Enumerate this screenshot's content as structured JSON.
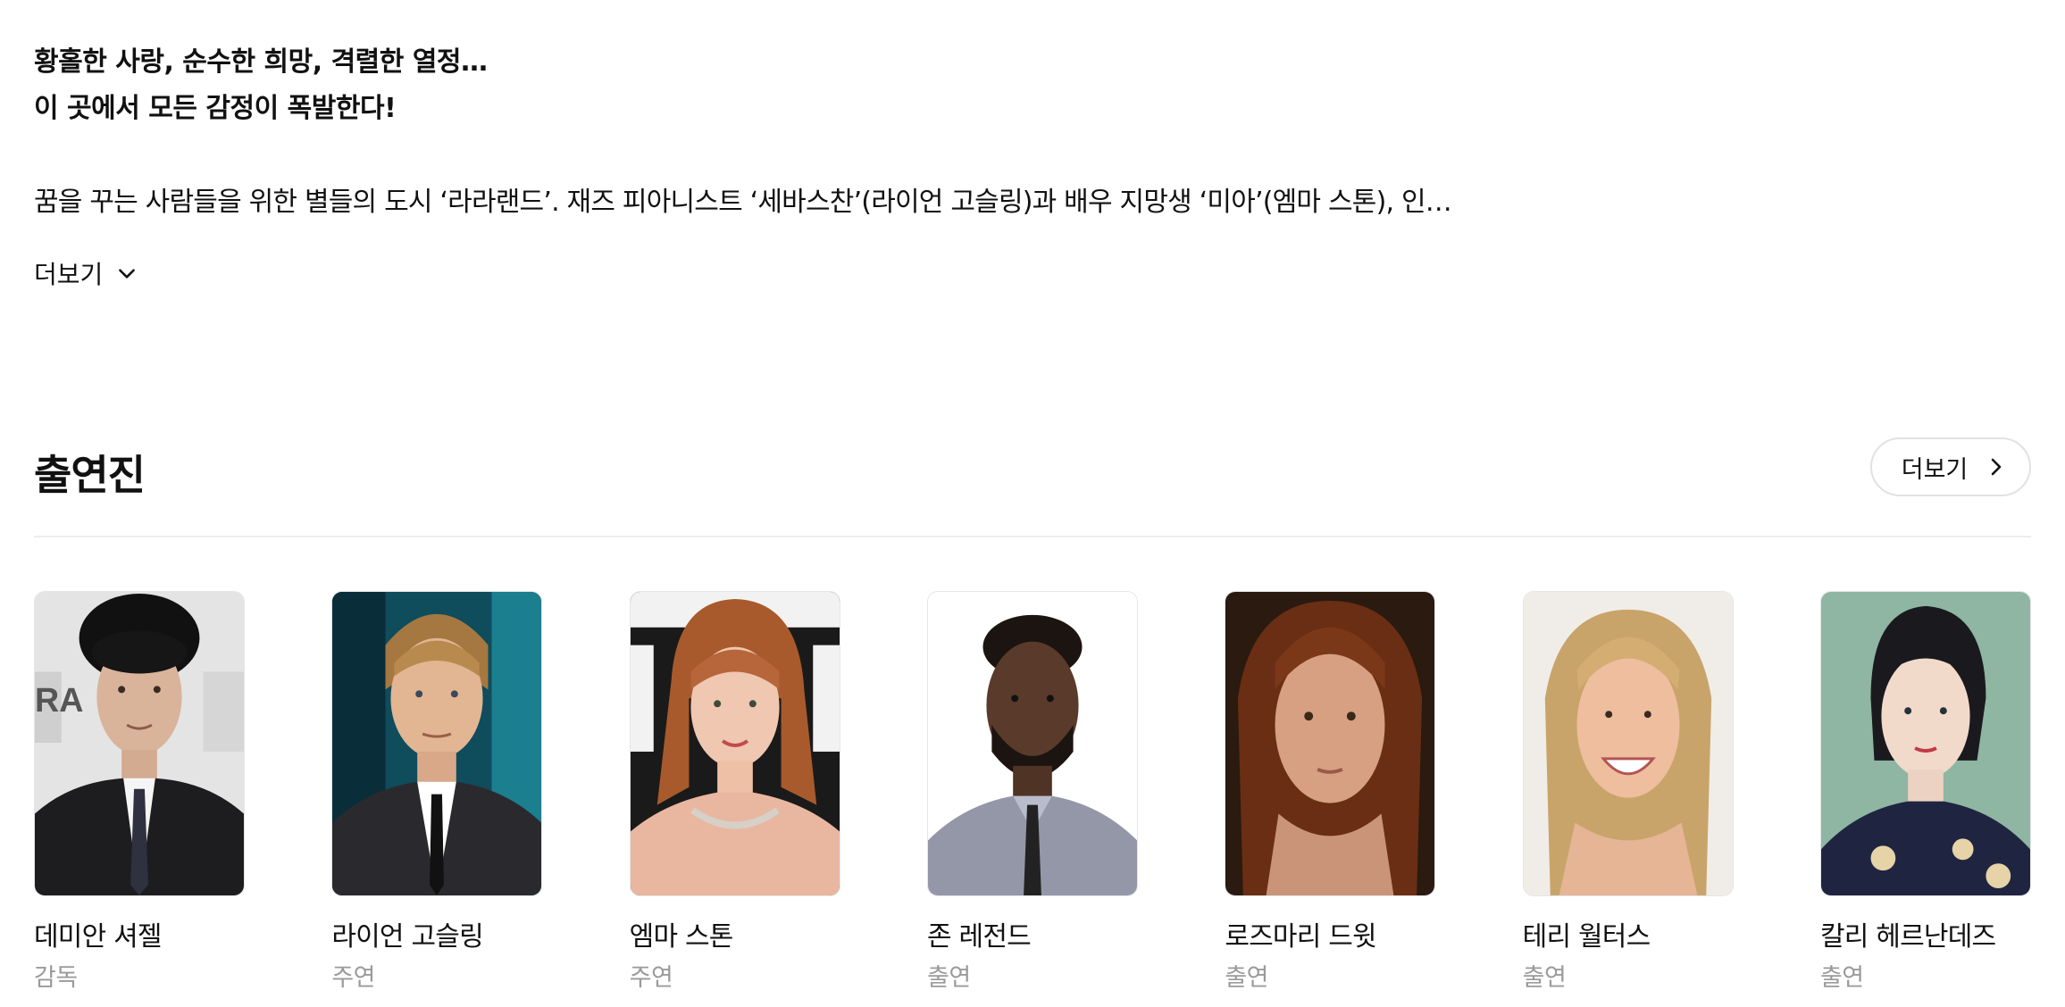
{
  "synopsis": {
    "tagline_line1": "황홀한 사랑, 순수한 희망, 격렬한 열정…",
    "tagline_line2": "이 곳에서 모든 감정이 폭발한다!",
    "body": "꿈을 꾸는 사람들을 위한 별들의 도시 ‘라라랜드’. 재즈 피아니스트 ‘세바스찬’(라이언 고슬링)과 배우 지망생 ‘미아’(엠마 스톤), 인…",
    "more_label": "더보기"
  },
  "cast": {
    "title": "출연진",
    "more_label": "더보기",
    "members": [
      {
        "name": "데미안 셔젤",
        "role": "감독"
      },
      {
        "name": "라이언 고슬링",
        "role": "주연"
      },
      {
        "name": "엠마 스톤",
        "role": "주연"
      },
      {
        "name": "존 레전드",
        "role": "출연"
      },
      {
        "name": "로즈마리 드윗",
        "role": "출연"
      },
      {
        "name": "테리 월터스",
        "role": "출연"
      },
      {
        "name": "칼리 헤르난데즈",
        "role": "출연"
      }
    ]
  }
}
